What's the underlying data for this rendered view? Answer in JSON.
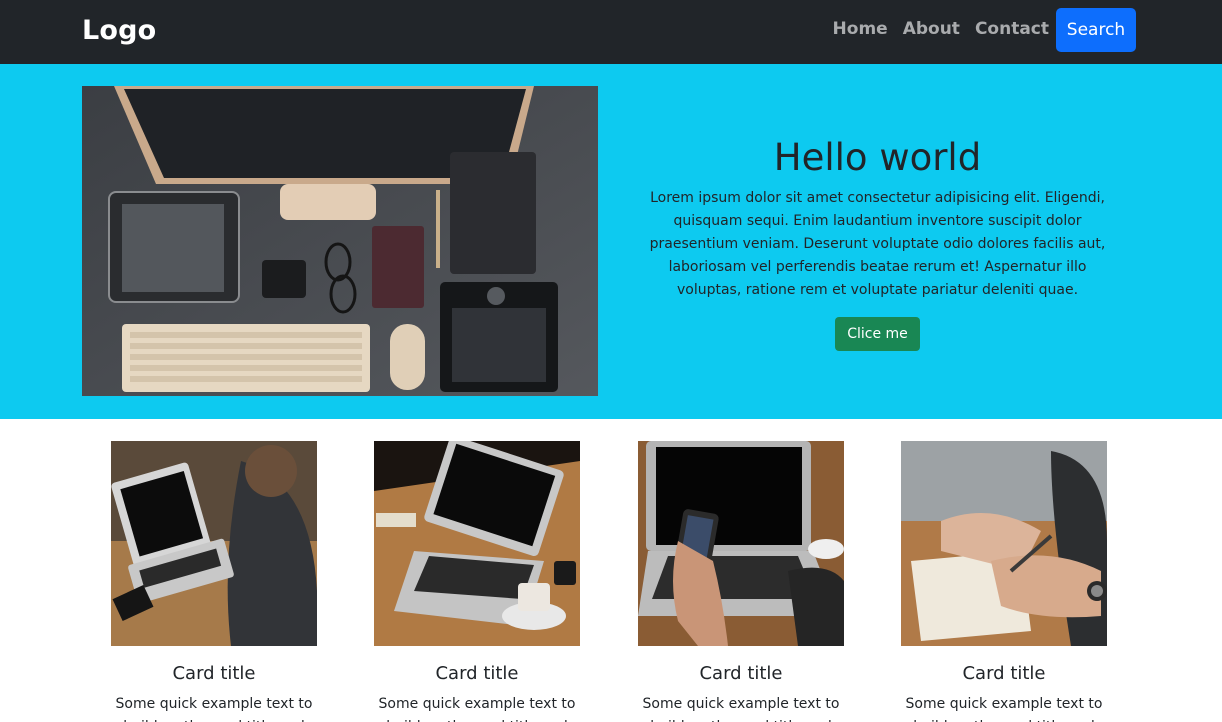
{
  "navbar": {
    "logo": "Logo",
    "links": [
      "Home",
      "About",
      "Contact"
    ],
    "search_label": "Search"
  },
  "hero": {
    "title": "Hello world",
    "body": "Lorem ipsum dolor sit amet consectetur adipisicing elit. Eligendi, quisquam sequi. Enim laudantium inventore suscipit dolor praesentium veniam. Deserunt voluptate odio dolores facilis aut, laboriosam vel perferendis beatae rerum et! Aspernatur illo voluptas, ratione rem et voluptate pariatur deleniti quae.",
    "button_label": "Clice me"
  },
  "cards": [
    {
      "title": "Card title",
      "text": "Some quick example text to build on the card title and"
    },
    {
      "title": "Card title",
      "text": "Some quick example text to build on the card title and"
    },
    {
      "title": "Card title",
      "text": "Some quick example text to build on the card title and"
    },
    {
      "title": "Card title",
      "text": "Some quick example text to build on the card title and"
    }
  ]
}
